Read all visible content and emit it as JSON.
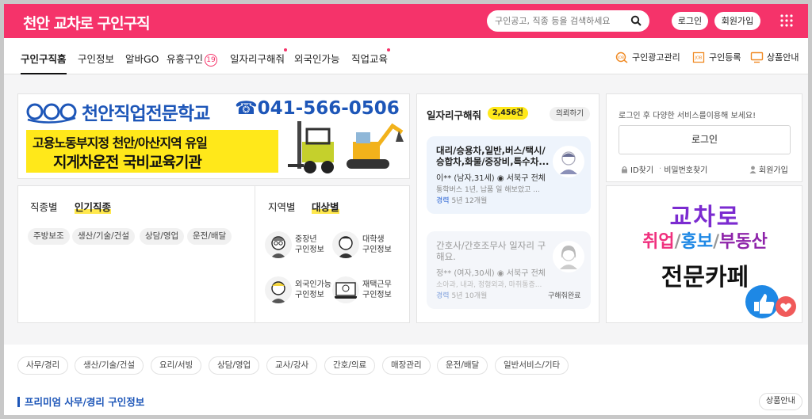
{
  "header": {
    "logo_prefix": "천안",
    "logo_brand": "교차로",
    "logo_suffix": "구인구직",
    "search_placeholder": "구인공고, 직종 등을 검색하세요",
    "login_label": "로그인",
    "join_label": "회원가입",
    "brand_color": "#f5336a"
  },
  "nav": {
    "items": [
      {
        "label": "구인구직홈",
        "active": true
      },
      {
        "label": "구인정보"
      },
      {
        "label": "알바GO"
      },
      {
        "label": "유흥구인",
        "badge": "19"
      },
      {
        "label": "일자리구해줘",
        "dot": true
      },
      {
        "label": "외국인가능"
      },
      {
        "label": "직업교육",
        "dot": true
      }
    ],
    "right": [
      {
        "label": "구인광고관리",
        "icon": "job-ad-icon"
      },
      {
        "label": "구인등록",
        "icon": "register-icon"
      },
      {
        "label": "상품안내",
        "icon": "monitor-icon"
      }
    ]
  },
  "banner": {
    "title": "천안직업전문학교",
    "phone": "☎041-566-0506",
    "line1": "고용노동부지정 천안/아산지역 유일",
    "line2": "지게차운전 국비교육기관"
  },
  "categories": {
    "tab_job": "직종별",
    "tab_popular": "인기직종",
    "popular_chips": [
      "주방보조",
      "생산/기술/건설",
      "상담/영업",
      "운전/배달"
    ],
    "tab_region": "지역별",
    "tab_target": "대상별",
    "targets": [
      {
        "label1": "중장년",
        "label2": "구인정보"
      },
      {
        "label1": "대학생",
        "label2": "구인정보"
      },
      {
        "label1": "외국인가능",
        "label2": "구인정보"
      },
      {
        "label1": "재택근무",
        "label2": "구인정보"
      }
    ]
  },
  "hire": {
    "title": "일자리구해줘",
    "count": "2,456건",
    "request_label": "의뢰하기",
    "items": [
      {
        "title": "대리/승용차,일반,버스/택시/승합차,화물/중장비,특수차...",
        "meta": "이** (남자,31세)",
        "region": "서북구 전체",
        "desc": "통학버스 1년, 납품 일 해보았고 ...",
        "exp_label": "경력",
        "exp_value": "5년 12개월"
      },
      {
        "title": "간호사/간호조무사 일자리 구해요.",
        "meta": "정** (여자,30세)",
        "region": "서북구 전체",
        "desc": "소아과, 내과, 정형외과, 마취통증...",
        "exp_label": "경력",
        "exp_value": "5년 10개월",
        "status": "구해줘완료"
      }
    ]
  },
  "login": {
    "message": "로그인 후 다양한 서비스를이용해 보세요!",
    "button": "로그인",
    "find_id": "ID찾기",
    "find_pw": "비밀번호찾기",
    "join": "회원가입"
  },
  "ad": {
    "line1": "교차로",
    "word1": "취업",
    "word2": "홍보",
    "word3": "부동산",
    "line3": "전문카페"
  },
  "bottom": {
    "chips": [
      "사무/경리",
      "생산/기술/건설",
      "요리/서빙",
      "상담/영업",
      "교사/강사",
      "간호/의료",
      "매장관리",
      "운전/배달",
      "일반서비스/기타"
    ],
    "premium_title": "프리미엄 사무/경리 구인정보",
    "premium_button": "상품안내"
  }
}
